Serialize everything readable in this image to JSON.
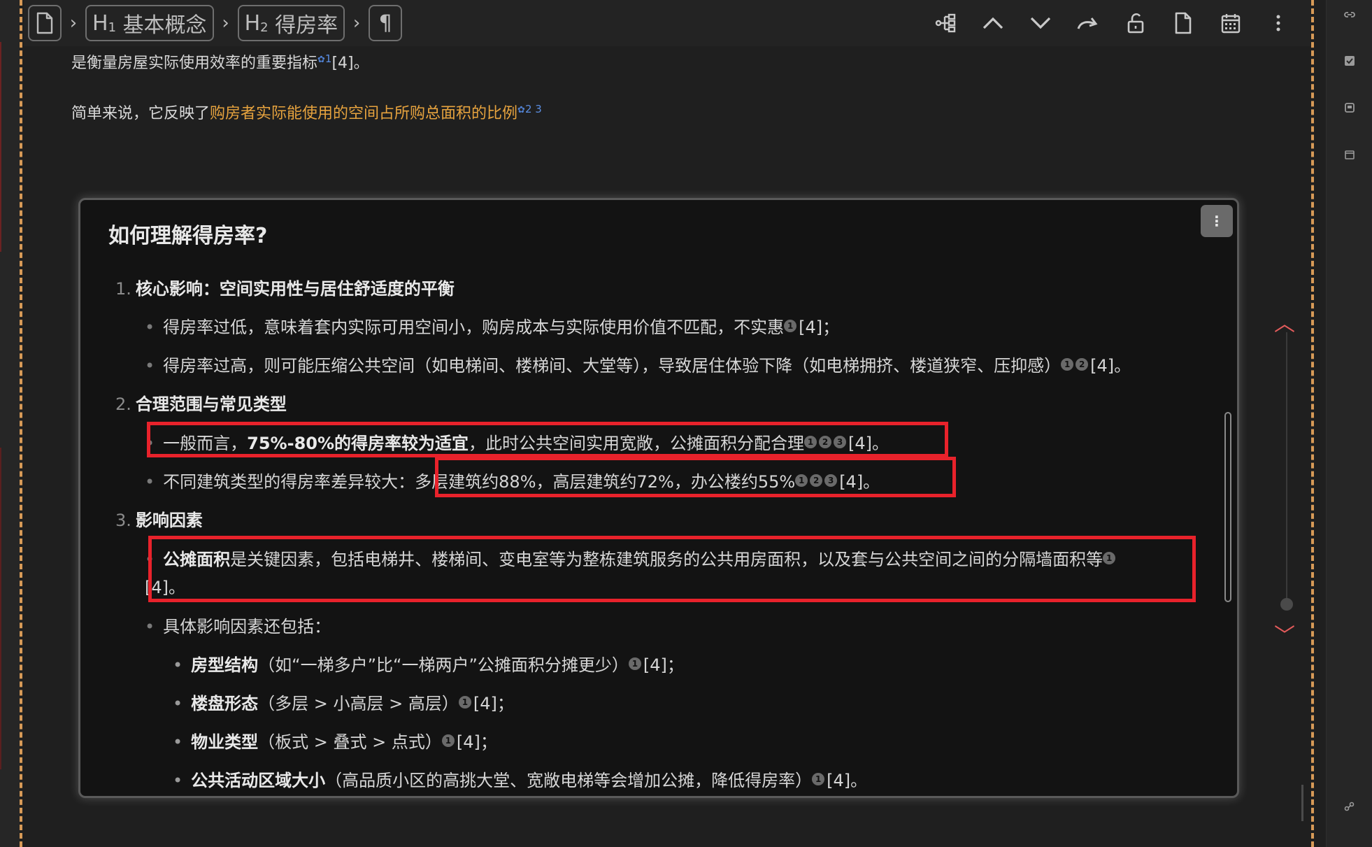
{
  "toolbar": {
    "crumbs": [
      {
        "prefix": "H",
        "level": "1",
        "label": "基本概念"
      },
      {
        "prefix": "H",
        "level": "2",
        "label": "得房率"
      }
    ],
    "pilcrow": "¶",
    "icons": [
      "file-icon",
      "outline-icon",
      "chevron-up-icon",
      "chevron-down-icon",
      "redo-icon",
      "unlock-icon",
      "document-icon",
      "calendar-icon",
      "more-vertical-icon"
    ]
  },
  "body": {
    "line1_text": "是衡量房屋实际使用效率的重要指标",
    "line1_sup": "1",
    "line1_ref": "[4]。",
    "line2_prefix": "简单来说，它反映了",
    "line2_highlight": "购房者实际能使用的空间占所购总面积的比例",
    "line2_sup": "2 3"
  },
  "panel": {
    "title": "如何理解得房率?",
    "menu_icon": "⋮",
    "sections": [
      {
        "num": "1.",
        "heading": "核心影响：空间实用性与居住舒适度的平衡",
        "bullets": [
          {
            "text": "得房率过低，意味着套内实际可用空间小，购房成本与实际使用价值不匹配，不实惠",
            "cites": [
              "1"
            ],
            "ref": "[4]；"
          },
          {
            "text": "得房率过高，则可能压缩公共空间（如电梯间、楼梯间、大堂等），导致居住体验下降（如电梯拥挤、楼道狭窄、压抑感）",
            "cites": [
              "1",
              "2"
            ],
            "ref": "[4]。"
          }
        ]
      },
      {
        "num": "2.",
        "heading": "合理范围与常见类型",
        "bullets": [
          {
            "pre": "一般而言，",
            "bold": "75%-80%的得房率较为适宜",
            "post": "，此时公共空间实用宽敞，公摊面积分配合理",
            "cites": [
              "1",
              "2",
              "3"
            ],
            "ref": "[4]。"
          },
          {
            "pre": "不同建筑类型的得房率差异较大：",
            "post": "多层建筑约88%，高层建筑约72%，办公楼约55%",
            "cites": [
              "1",
              "2",
              "3"
            ],
            "ref": "[4]。"
          }
        ]
      },
      {
        "num": "3.",
        "heading": "影响因素",
        "bullets": [
          {
            "bold": "公摊面积",
            "post": "是关键因素，包括电梯井、楼梯间、变电室等为整栋建筑服务的公共用房面积，以及套与公共空间之间的分隔墙面积等",
            "cites": [
              "1"
            ],
            "ref": "[4]。"
          },
          {
            "post": "具体影响因素还包括："
          }
        ],
        "sub_bullets": [
          {
            "bold": "房型结构",
            "post": "（如“一梯多户”比“一梯两户”公摊面积分摊更少）",
            "cites": [
              "1"
            ],
            "ref": "[4]；"
          },
          {
            "bold": "楼盘形态",
            "post": "（多层 > 小高层 > 高层）",
            "cites": [
              "1"
            ],
            "ref": "[4]；"
          },
          {
            "bold": "物业类型",
            "post": "（板式 > 叠式 > 点式）",
            "cites": [
              "1"
            ],
            "ref": "[4]；"
          },
          {
            "bold": "公共活动区域大小",
            "post": "（高品质小区的高挑大堂、宽敞电梯等会增加公摊，降低得房率）",
            "cites": [
              "1"
            ],
            "ref": "[4]。"
          }
        ]
      }
    ]
  },
  "sidebar": {
    "icons": [
      "link-icon",
      "checkbox-icon",
      "small-square-icon",
      "calendar-small-icon",
      "graph-icon"
    ]
  },
  "nav": {
    "up": "︿",
    "down": "﹀"
  },
  "colors": {
    "highlight": "#e7a33e",
    "annotation_box": "#e8222b",
    "dashed_border": "#d79a57"
  }
}
